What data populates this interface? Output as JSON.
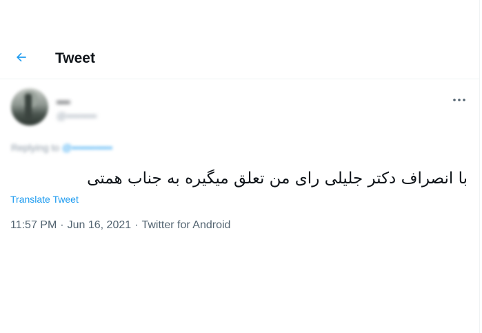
{
  "header": {
    "back_icon": "arrow-left-icon",
    "title": "Tweet"
  },
  "author": {
    "display_name": "••••",
    "handle": "@•••••••••"
  },
  "tweet": {
    "more_icon": "more-horizontal-icon",
    "replying_prefix": "Replying to",
    "replying_to": "@••••••••••••",
    "text": "با انصراف دکتر جلیلی رای من تعلق میگیره به جناب همتی",
    "translate_label": "Translate Tweet",
    "time": "11:57 PM",
    "separator": "·",
    "date": "Jun 16, 2021",
    "source": "Twitter for Android"
  },
  "colors": {
    "accent": "#1d9bf0",
    "text_primary": "#0f1419",
    "text_secondary": "#536471",
    "divider": "#eff3f4"
  }
}
